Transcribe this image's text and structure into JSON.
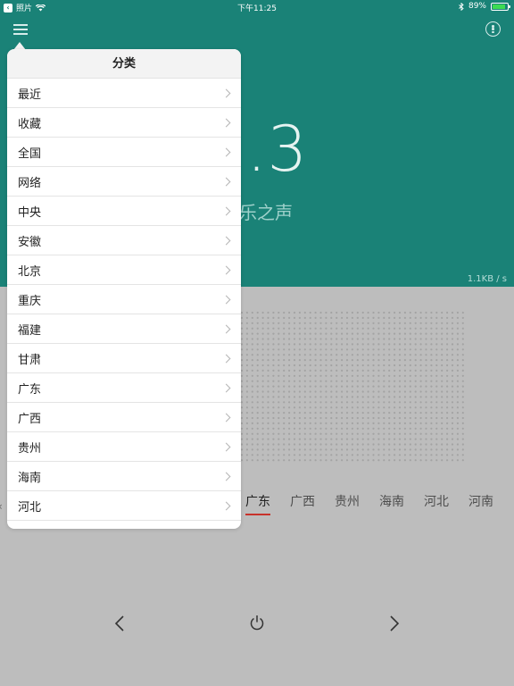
{
  "status_bar": {
    "back_app": "照片",
    "time": "下午11:25",
    "battery": "89%",
    "battery_level": 0.89
  },
  "header": {
    "frequency": "9.3",
    "station": "音乐之声",
    "speed": "1.1KB / s"
  },
  "tabs": [
    {
      "label": "广东",
      "active": true
    },
    {
      "label": "广西",
      "active": false
    },
    {
      "label": "贵州",
      "active": false
    },
    {
      "label": "海南",
      "active": false
    },
    {
      "label": "河北",
      "active": false
    },
    {
      "label": "河南",
      "active": false
    }
  ],
  "popover": {
    "title": "分类",
    "items": [
      "最近",
      "收藏",
      "全国",
      "网络",
      "中央",
      "安徽",
      "北京",
      "重庆",
      "福建",
      "甘肃",
      "广东",
      "广西",
      "贵州",
      "海南",
      "河北"
    ]
  },
  "colors": {
    "header_bg": "#1a8277",
    "body_bg": "#bdbdbd",
    "active_underline": "#c8322b"
  },
  "icons": {
    "menu": "hamburger-icon",
    "more": "more-options-icon",
    "prev": "chevron-left-icon",
    "power": "power-icon",
    "next": "chevron-right-icon"
  }
}
